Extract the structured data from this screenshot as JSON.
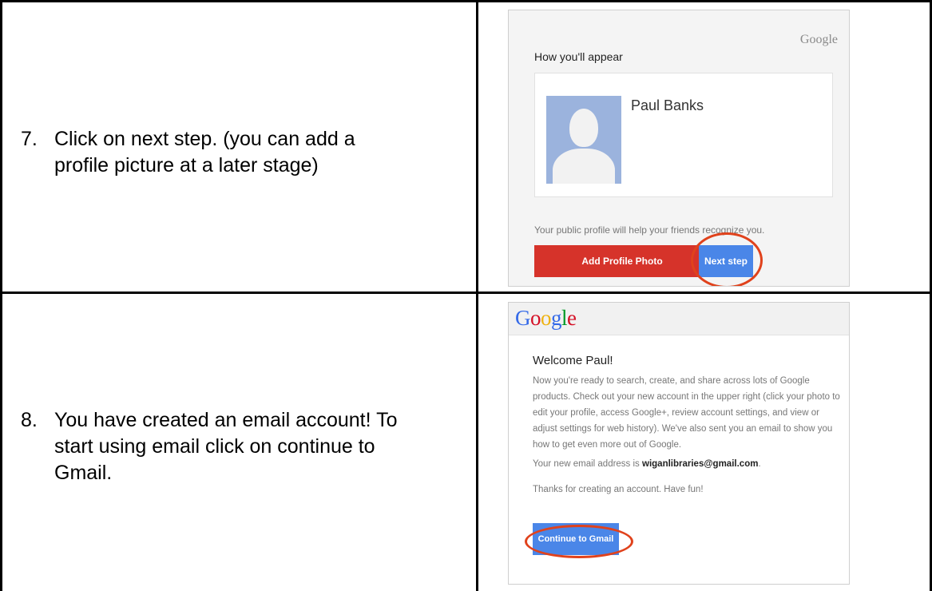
{
  "steps": [
    {
      "number": "7.",
      "line1": "Click on next step. (you can add a",
      "line2": "profile picture at a later stage)"
    },
    {
      "number": "8.",
      "line1": "You have created an email account! To",
      "line2": "start using email click on continue to",
      "line3": "Gmail."
    }
  ],
  "profile_screen": {
    "brand": "Google",
    "heading": "How you'll appear",
    "name": "Paul Banks",
    "help_text": "Your public profile will help your friends recognize you.",
    "add_photo_label": "Add Profile Photo",
    "next_label": "Next step",
    "accent_color": "#4a86e8",
    "photo_button_color": "#d6332a",
    "highlight_color": "#e0421c"
  },
  "welcome_screen": {
    "logo_letters": [
      "G",
      "o",
      "o",
      "g",
      "l",
      "e"
    ],
    "logo_colors": [
      "#3369e8",
      "#d50f25",
      "#eeb211",
      "#3369e8",
      "#009925",
      "#d50f25"
    ],
    "greeting": "Welcome Paul!",
    "body": "Now you're ready to search, create, and share across lots of Google products. Check out your new account in the upper right (click your photo to edit your profile, access Google+, review account settings, and view or adjust settings for web history). We've also sent you an email to show you how to get even more out of Google.",
    "email_prefix": "Your new email address is ",
    "email": "wiganlibraries@gmail.com",
    "email_suffix": ".",
    "thanks": "Thanks for creating an account. Have fun!",
    "continue_label": "Continue to Gmail"
  }
}
